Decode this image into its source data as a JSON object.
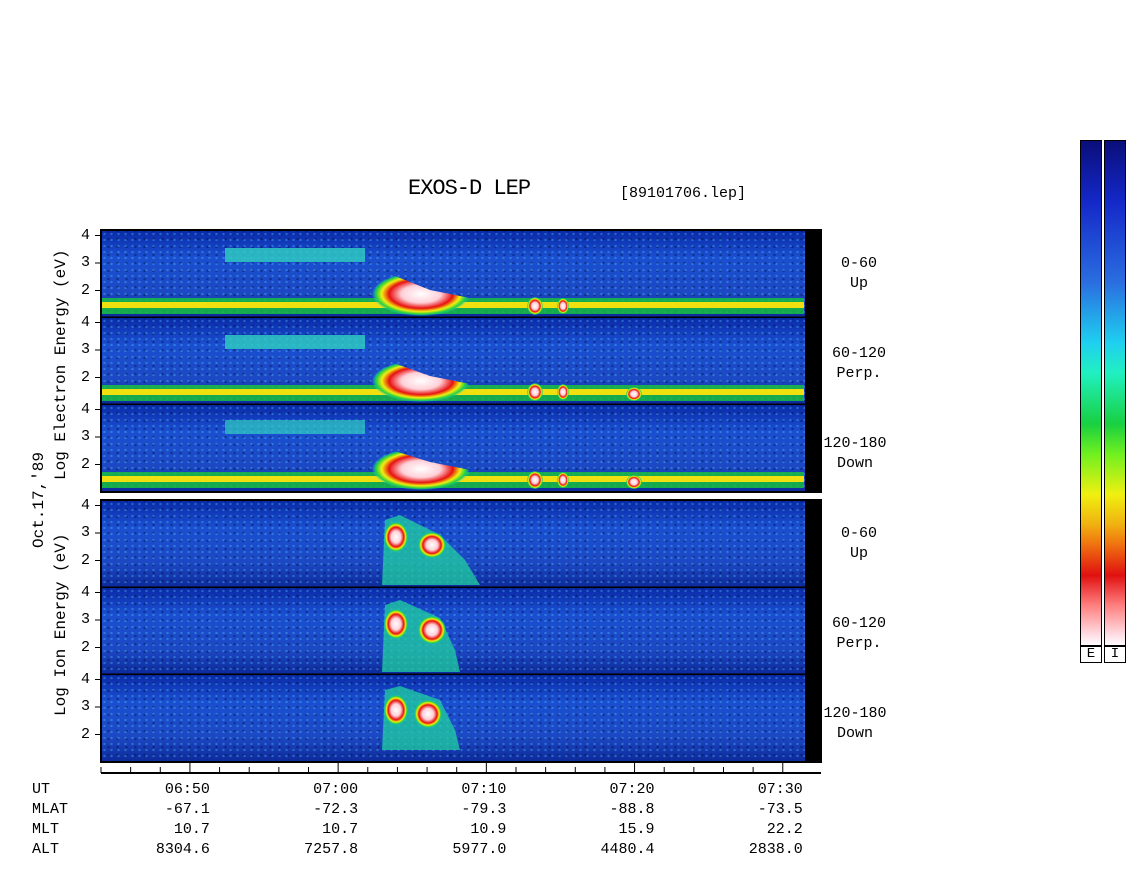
{
  "chart_data": {
    "type": "heatmap",
    "title": "EXOS-D LEP",
    "file": "[89101706.lep]",
    "date_label": "Oct.17,'89",
    "species": [
      {
        "name": "Electron",
        "ylabel": "Log  Electron  Energy (eV)",
        "panels": [
          {
            "range": "0-60",
            "direction": "Up"
          },
          {
            "range": "60-120",
            "direction": "Perp."
          },
          {
            "range": "120-180",
            "direction": "Down"
          }
        ]
      },
      {
        "name": "Ion",
        "ylabel": "Log  Ion  Energy (eV)",
        "panels": [
          {
            "range": "0-60",
            "direction": "Up"
          },
          {
            "range": "60-120",
            "direction": "Perp."
          },
          {
            "range": "120-180",
            "direction": "Down"
          }
        ]
      }
    ],
    "y_ticks": [
      "4",
      "3",
      "2"
    ],
    "ylim": [
      1,
      4.2
    ],
    "x_ticks": [
      "06:50",
      "07:00",
      "07:10",
      "07:20",
      "07:30"
    ],
    "x_minutes": [
      -10,
      0,
      10,
      20,
      30
    ],
    "xlim_minutes": [
      -16,
      31.5
    ],
    "rows": [
      {
        "label": "UT",
        "values": [
          "06:50",
          "07:00",
          "07:10",
          "07:20",
          "07:30"
        ]
      },
      {
        "label": "MLAT",
        "values": [
          "-67.1",
          "-72.3",
          "-79.3",
          "-88.8",
          "-73.5"
        ]
      },
      {
        "label": "MLT",
        "values": [
          "10.7",
          "10.7",
          "10.9",
          "15.9",
          "22.2"
        ]
      },
      {
        "label": "ALT",
        "values": [
          "8304.6",
          "7257.8",
          "5977.0",
          "4480.4",
          "2838.0"
        ]
      }
    ],
    "colorbar_labels": [
      "E",
      "I"
    ],
    "grid": false
  }
}
